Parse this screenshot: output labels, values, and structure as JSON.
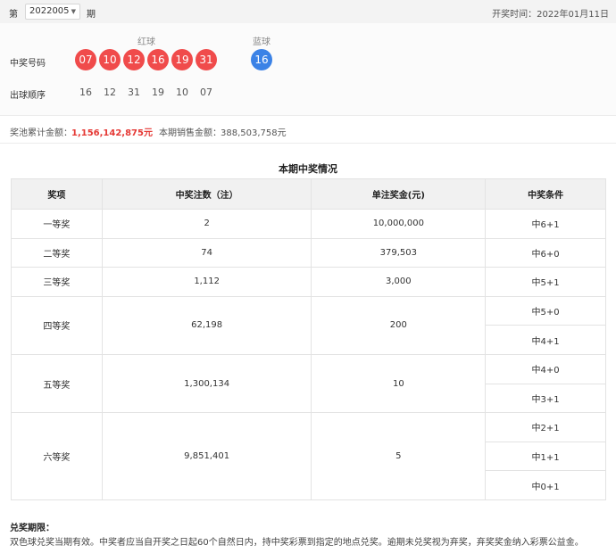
{
  "header": {
    "prefix": "第",
    "issue": "2022005",
    "suffix": "期",
    "draw_time": "开奖时间：2022年01月11日"
  },
  "balls": {
    "red_title": "红球",
    "blue_title": "蓝球",
    "win_label": "中奖号码",
    "order_label": "出球顺序",
    "red": [
      "07",
      "10",
      "12",
      "16",
      "19",
      "31"
    ],
    "blue": "16",
    "order": [
      "16",
      "12",
      "31",
      "19",
      "10",
      "07"
    ],
    "colors": {
      "red": "#f04b4b",
      "blue": "#3b82e6"
    }
  },
  "pool": {
    "pool_label": "奖池累计金额：",
    "pool_value": "1,156,142,875元",
    "sales_label": "本期销售金额：",
    "sales_value": "388,503,758元"
  },
  "table": {
    "title": "本期中奖情况",
    "headers": [
      "奖项",
      "中奖注数（注）",
      "单注奖金(元)",
      "中奖条件"
    ],
    "rows": [
      {
        "name": "一等奖",
        "count": "2",
        "prize": "10,000,000",
        "conditions": [
          "中6+1"
        ]
      },
      {
        "name": "二等奖",
        "count": "74",
        "prize": "379,503",
        "conditions": [
          "中6+0"
        ]
      },
      {
        "name": "三等奖",
        "count": "1,112",
        "prize": "3,000",
        "conditions": [
          "中5+1"
        ]
      },
      {
        "name": "四等奖",
        "count": "62,198",
        "prize": "200",
        "conditions": [
          "中5+0",
          "中4+1"
        ]
      },
      {
        "name": "五等奖",
        "count": "1,300,134",
        "prize": "10",
        "conditions": [
          "中4+0",
          "中3+1"
        ]
      },
      {
        "name": "六等奖",
        "count": "9,851,401",
        "prize": "5",
        "conditions": [
          "中2+1",
          "中1+1",
          "中0+1"
        ]
      }
    ]
  },
  "rules": {
    "title": "兑奖期限：",
    "text": "双色球兑奖当期有效。中奖者应当自开奖之日起60个自然日内，持中奖彩票到指定的地点兑奖。逾期未兑奖视为弃奖，弃奖奖金纳入彩票公益金。"
  }
}
